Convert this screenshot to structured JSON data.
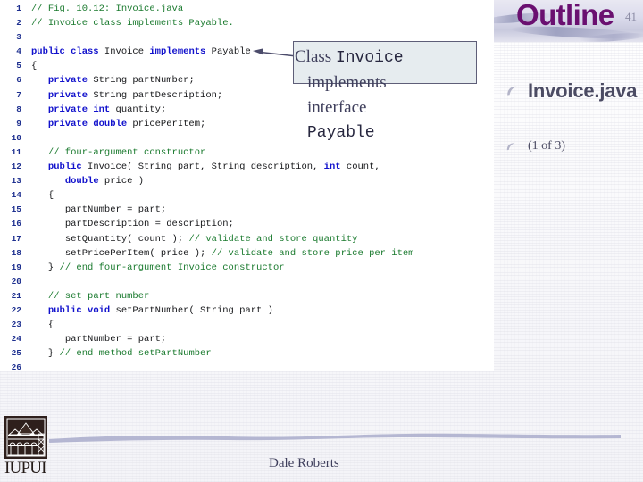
{
  "header": {
    "title": "Outline",
    "slide_number": "41",
    "title_color": "#6a1070"
  },
  "outline": {
    "items": [
      {
        "label": "Invoice.java",
        "level": 1,
        "bullet_icon": "crescent-bullet-icon"
      },
      {
        "label": "(1 of 3)",
        "level": 2,
        "bullet_icon": "crescent-bullet-icon"
      }
    ]
  },
  "callout": {
    "line1_plain": "Class ",
    "line1_mono": "Invoice",
    "line2": "implements",
    "line3": "interface",
    "line4_mono": "Payable",
    "box_fill": "#e6ecef",
    "box_border": "#5e5e78",
    "arrow_icon": "left-arrow-icon"
  },
  "code": {
    "language": "java",
    "lines": [
      {
        "n": "1",
        "tokens": [
          {
            "t": "// Fig. 10.12: Invoice.java",
            "c": "cm",
            "indent": 0
          }
        ]
      },
      {
        "n": "2",
        "tokens": [
          {
            "t": "// Invoice class implements Payable.",
            "c": "cm",
            "indent": 0
          }
        ]
      },
      {
        "n": "3",
        "tokens": []
      },
      {
        "n": "4",
        "tokens": [
          {
            "t": "public class ",
            "c": "kw",
            "indent": 0
          },
          {
            "t": "Invoice ",
            "c": "id"
          },
          {
            "t": "implements ",
            "c": "kw"
          },
          {
            "t": "Payable",
            "c": "id"
          }
        ]
      },
      {
        "n": "5",
        "tokens": [
          {
            "t": "{",
            "c": "id",
            "indent": 0
          }
        ]
      },
      {
        "n": "6",
        "tokens": [
          {
            "t": "private ",
            "c": "kw",
            "indent": 3
          },
          {
            "t": "String partNumber;",
            "c": "id"
          }
        ]
      },
      {
        "n": "7",
        "tokens": [
          {
            "t": "private ",
            "c": "kw",
            "indent": 3
          },
          {
            "t": "String partDescription;",
            "c": "id"
          }
        ]
      },
      {
        "n": "8",
        "tokens": [
          {
            "t": "private int ",
            "c": "kw",
            "indent": 3
          },
          {
            "t": "quantity;",
            "c": "id"
          }
        ]
      },
      {
        "n": "9",
        "tokens": [
          {
            "t": "private double ",
            "c": "kw",
            "indent": 3
          },
          {
            "t": "pricePerItem;",
            "c": "id"
          }
        ]
      },
      {
        "n": "10",
        "tokens": []
      },
      {
        "n": "11",
        "tokens": [
          {
            "t": "// four-argument constructor",
            "c": "cm",
            "indent": 3
          }
        ]
      },
      {
        "n": "12",
        "tokens": [
          {
            "t": "public ",
            "c": "kw",
            "indent": 3
          },
          {
            "t": "Invoice( String part, String description, ",
            "c": "id"
          },
          {
            "t": "int ",
            "c": "kw"
          },
          {
            "t": "count,",
            "c": "id"
          }
        ]
      },
      {
        "n": "13",
        "tokens": [
          {
            "t": "double ",
            "c": "kw",
            "indent": 6
          },
          {
            "t": "price )",
            "c": "id"
          }
        ]
      },
      {
        "n": "14",
        "tokens": [
          {
            "t": "{",
            "c": "id",
            "indent": 3
          }
        ]
      },
      {
        "n": "15",
        "tokens": [
          {
            "t": "partNumber = part;",
            "c": "id",
            "indent": 6
          }
        ]
      },
      {
        "n": "16",
        "tokens": [
          {
            "t": "partDescription = description;",
            "c": "id",
            "indent": 6
          }
        ]
      },
      {
        "n": "17",
        "tokens": [
          {
            "t": "setQuantity( count ); ",
            "c": "id",
            "indent": 6
          },
          {
            "t": "// validate and store quantity",
            "c": "cm"
          }
        ]
      },
      {
        "n": "18",
        "tokens": [
          {
            "t": "setPricePerItem( price ); ",
            "c": "id",
            "indent": 6
          },
          {
            "t": "// validate and store price per item",
            "c": "cm"
          }
        ]
      },
      {
        "n": "19",
        "tokens": [
          {
            "t": "} ",
            "c": "id",
            "indent": 3
          },
          {
            "t": "// end four-argument Invoice constructor",
            "c": "cm"
          }
        ]
      },
      {
        "n": "20",
        "tokens": []
      },
      {
        "n": "21",
        "tokens": [
          {
            "t": "// set part number",
            "c": "cm",
            "indent": 3
          }
        ]
      },
      {
        "n": "22",
        "tokens": [
          {
            "t": "public void ",
            "c": "kw",
            "indent": 3
          },
          {
            "t": "setPartNumber( String part )",
            "c": "id"
          }
        ]
      },
      {
        "n": "23",
        "tokens": [
          {
            "t": "{",
            "c": "id",
            "indent": 3
          }
        ]
      },
      {
        "n": "24",
        "tokens": [
          {
            "t": "partNumber = part;",
            "c": "id",
            "indent": 6
          }
        ]
      },
      {
        "n": "25",
        "tokens": [
          {
            "t": "} ",
            "c": "id",
            "indent": 3
          },
          {
            "t": "// end method setPartNumber",
            "c": "cm"
          }
        ]
      },
      {
        "n": "26",
        "tokens": []
      }
    ]
  },
  "footer": {
    "author": "Dale Roberts",
    "logo_text": "IUPUI",
    "logo_icon": "iupui-building-logo-icon",
    "swoosh_icon": "decorative-swoosh-icon"
  }
}
